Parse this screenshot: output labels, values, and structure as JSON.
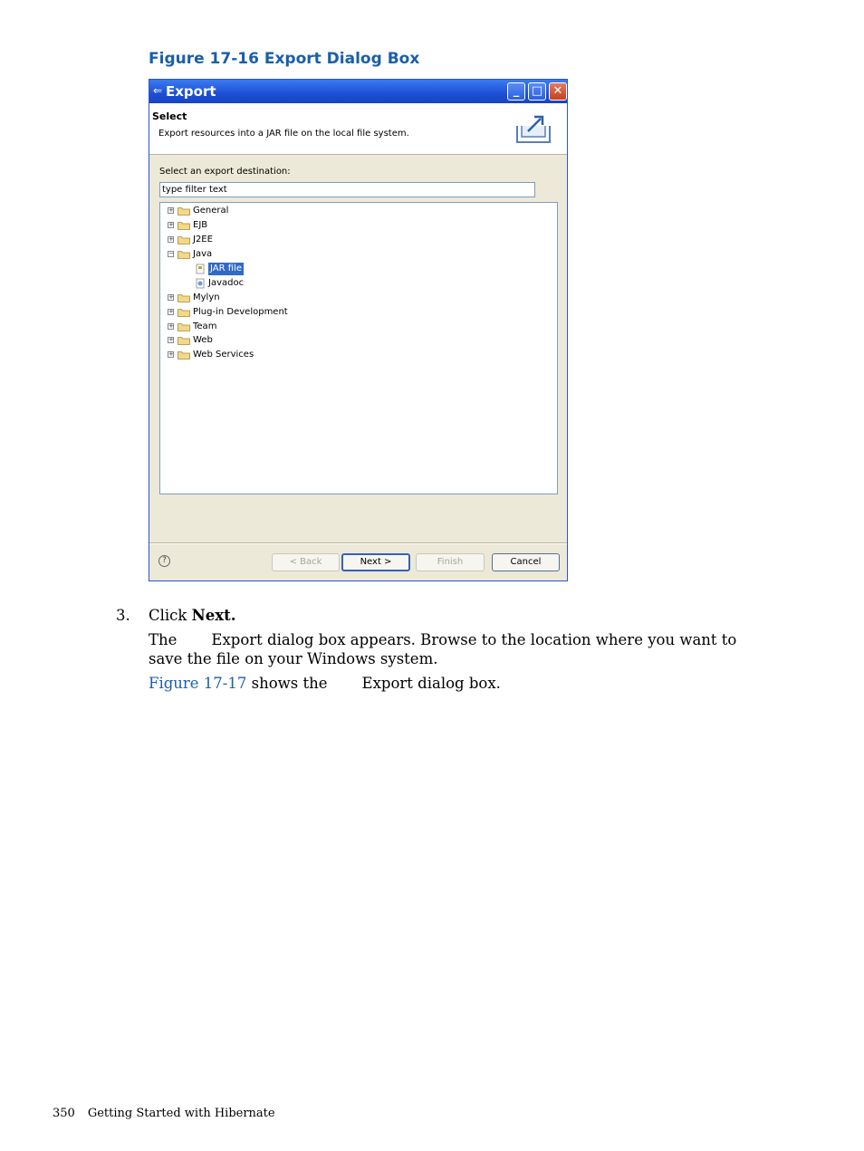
{
  "figure": {
    "caption": "Figure 17-16 Export Dialog Box"
  },
  "dialog": {
    "title": "Export",
    "header_title": "Select",
    "header_description": "Export resources into a JAR file on the local file system.",
    "destination_label": "Select an export destination:",
    "filter_placeholder": "type filter text",
    "tree": [
      {
        "label": "General",
        "expanded": false
      },
      {
        "label": "EJB",
        "expanded": false
      },
      {
        "label": "J2EE",
        "expanded": false
      },
      {
        "label": "Java",
        "expanded": true
      },
      {
        "label": "JAR file",
        "child": true,
        "selected": true
      },
      {
        "label": "Javadoc",
        "child": true
      },
      {
        "label": "Mylyn",
        "expanded": false
      },
      {
        "label": "Plug-in Development",
        "expanded": false
      },
      {
        "label": "Team",
        "expanded": false
      },
      {
        "label": "Web",
        "expanded": false
      },
      {
        "label": "Web Services",
        "expanded": false
      }
    ],
    "buttons": {
      "back": "< Back",
      "next": "Next >",
      "finish": "Finish",
      "cancel": "Cancel"
    },
    "colors": {
      "titlebar": "#1d4fd6",
      "selection": "#316ac5",
      "dialog_bg": "#ece9d8"
    }
  },
  "steps": {
    "number": "3.",
    "click_prefix": "Click ",
    "click_target": "Next.",
    "para1_start": "The",
    "para1_rest": "Export dialog box appears. Browse to the location where you want to save the file on your Windows system.",
    "para2_link": "Figure 17-17",
    "para2_middle": " shows the",
    "para2_end": "Export dialog box."
  },
  "footer": {
    "page_number": "350",
    "book_title": "Getting Started with Hibernate"
  }
}
